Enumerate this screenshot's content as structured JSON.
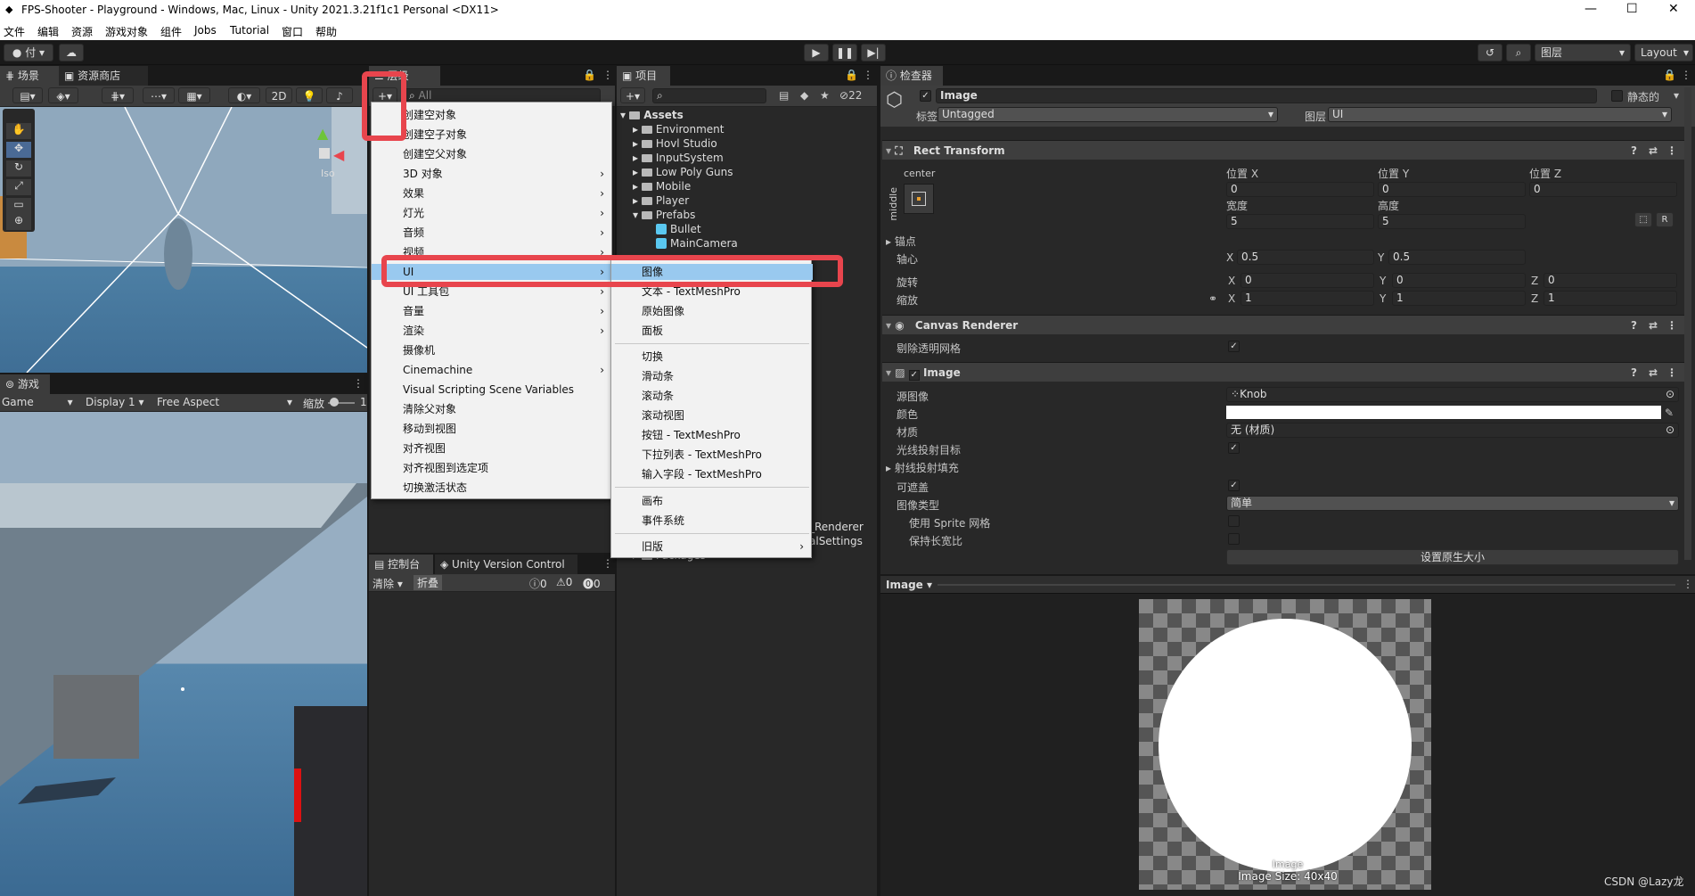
{
  "window": {
    "title": "FPS-Shooter - Playground - Windows, Mac, Linux - Unity 2021.3.21f1c1 Personal <DX11>",
    "minimize": "—",
    "maximize": "☐",
    "close": "✕"
  },
  "menubar": [
    "文件",
    "编辑",
    "资源",
    "游戏对象",
    "组件",
    "Jobs",
    "Tutorial",
    "窗口",
    "帮助"
  ],
  "toolbar": {
    "account": "付",
    "layers": "图层",
    "layout": "Layout"
  },
  "scene": {
    "tab_scene": "场景",
    "tab_store": "资源商店",
    "btn_2d": "2D",
    "iso": "Iso"
  },
  "game": {
    "tab": "游戏",
    "display": "Game",
    "display1": "Display 1",
    "aspect": "Free Aspect",
    "scale": "缩放",
    "scale_val": "1"
  },
  "hierarchy": {
    "tab": "层级",
    "search_placeholder": "All"
  },
  "console": {
    "tab": "控制台",
    "tab2": "Unity Version Control",
    "clear": "清除",
    "collapse": "折叠",
    "c0": "0",
    "c1": "0",
    "c2": "0"
  },
  "project": {
    "tab": "项目",
    "count": "22",
    "items": [
      {
        "label": "Assets",
        "type": "root"
      },
      {
        "label": "Environment",
        "type": "folder"
      },
      {
        "label": "Hovl Studio",
        "type": "folder"
      },
      {
        "label": "InputSystem",
        "type": "folder"
      },
      {
        "label": "Low Poly Guns",
        "type": "folder"
      },
      {
        "label": "Mobile",
        "type": "folder"
      },
      {
        "label": "Player",
        "type": "folder"
      },
      {
        "label": "Prefabs",
        "type": "folder"
      },
      {
        "label": "Bullet",
        "type": "prefab"
      },
      {
        "label": "MainCamera",
        "type": "prefab"
      }
    ],
    "partial1": "_Renderer",
    "partial2": "alSettings",
    "packages": "Packages"
  },
  "menu1": [
    "创建空对象",
    "创建空子对象",
    "创建空父对象",
    "3D 对象",
    "效果",
    "灯光",
    "音频",
    "视频",
    "UI",
    "UI 工具包",
    "音量",
    "渲染",
    "摄像机",
    "Cinemachine",
    "Visual Scripting Scene Variables",
    "清除父对象",
    "移动到视图",
    "对齐视图",
    "对齐视图到选定项",
    "切换激活状态"
  ],
  "menu2": [
    "图像",
    "文本 - TextMeshPro",
    "原始图像",
    "面板",
    "切换",
    "滑动条",
    "滚动条",
    "滚动视图",
    "按钮 - TextMeshPro",
    "下拉列表 - TextMeshPro",
    "输入字段 - TextMeshPro",
    "画布",
    "事件系统",
    "旧版"
  ],
  "inspector": {
    "tab": "检查器",
    "name": "Image",
    "static": "静态的",
    "tag_label": "标签",
    "tag": "Untagged",
    "layer_label": "图层",
    "layer": "UI",
    "rect": {
      "title": "Rect Transform",
      "anchor_h": "center",
      "anchor_v": "middle",
      "posx": "位置 X",
      "posy": "位置 Y",
      "posz": "位置 Z",
      "vx": "0",
      "vy": "0",
      "vz": "0",
      "width": "宽度",
      "height": "高度",
      "w": "5",
      "h": "5",
      "anchors": "锚点",
      "pivot": "轴心",
      "pivx": "0.5",
      "pivy": "0.5",
      "rotation": "旋转",
      "rx": "0",
      "ry": "0",
      "rz": "0",
      "scale": "缩放",
      "sx": "1",
      "sy": "1",
      "sz": "1",
      "r_btn": "R"
    },
    "canvas": {
      "title": "Canvas Renderer",
      "cull": "剔除透明网格"
    },
    "image": {
      "title": "Image",
      "source": "源图像",
      "source_val": "Knob",
      "color": "颜色",
      "material": "材质",
      "material_val": "无 (材质)",
      "raycast": "光线投射目标",
      "raycast_pad": "射线投射填充",
      "maskable": "可遮盖",
      "type": "图像类型",
      "type_val": "简单",
      "use_sprite": "使用 Sprite 网格",
      "preserve": "保持长宽比",
      "native": "设置原生大小"
    },
    "preview": {
      "title": "Image",
      "caption": "Image",
      "size": "Image Size: 40x40"
    }
  },
  "watermark": "CSDN @Lazy龙"
}
